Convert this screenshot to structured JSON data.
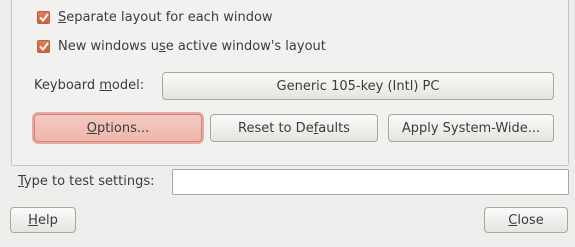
{
  "checkboxes": [
    {
      "pre": "",
      "mn": "S",
      "post": "eparate layout for each window",
      "checked": true
    },
    {
      "pre": "New windows u",
      "mn": "s",
      "post": "e active window's layout",
      "checked": true
    }
  ],
  "keyboard_model": {
    "label_pre": "Keyboard ",
    "label_mn": "m",
    "label_post": "odel:",
    "value": "Generic 105-key (Intl) PC"
  },
  "buttons": {
    "options": {
      "pre": "",
      "mn": "O",
      "post": "ptions..."
    },
    "reset": {
      "pre": "Reset to De",
      "mn": "f",
      "post": "aults"
    },
    "apply": {
      "label": "Apply System-Wide..."
    }
  },
  "test": {
    "label_pre": "",
    "label_mn": "T",
    "label_post": "ype to test settings:",
    "value": ""
  },
  "footer": {
    "help": {
      "pre": "",
      "mn": "H",
      "post": "elp"
    },
    "close": {
      "pre": "",
      "mn": "C",
      "post": "lose"
    }
  },
  "colors": {
    "accent": "#dd6a40",
    "focus": "#efb6ab"
  }
}
